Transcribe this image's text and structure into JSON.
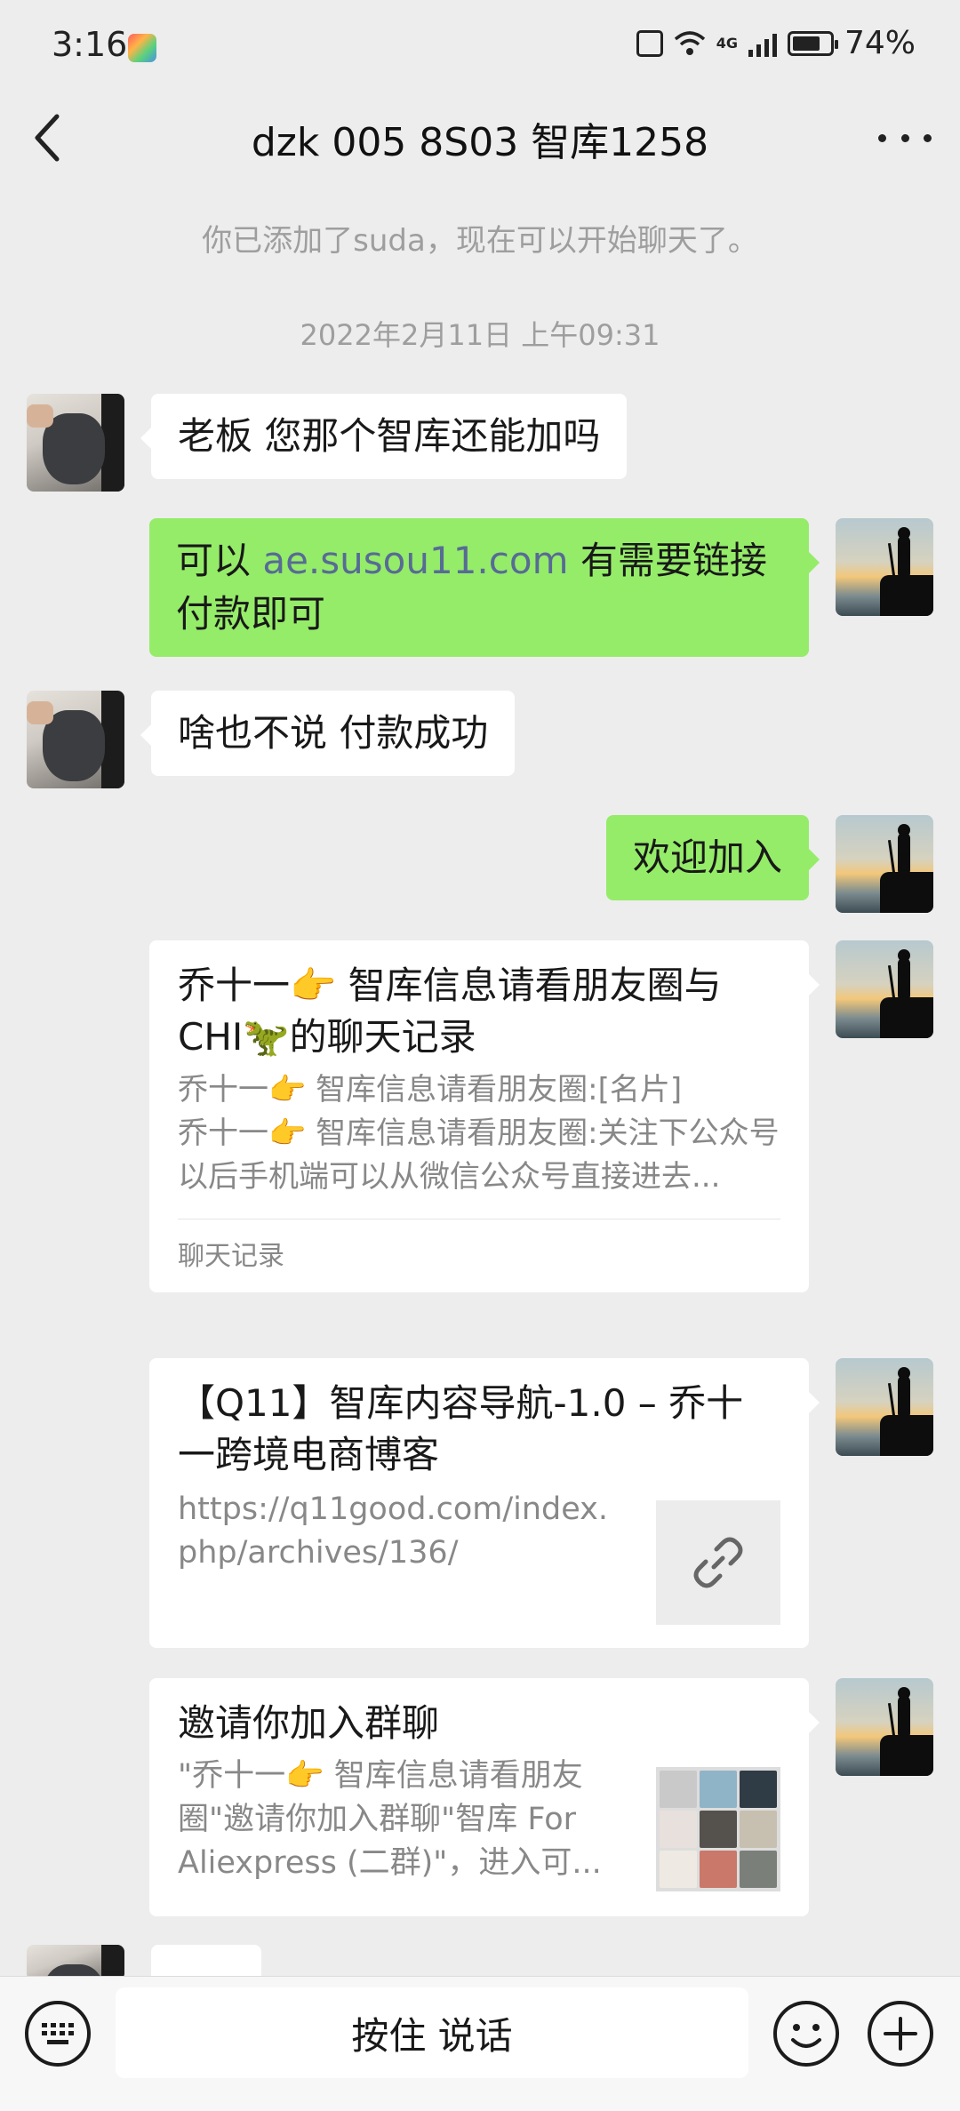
{
  "status_bar": {
    "time": "3:16",
    "network": "4G",
    "battery": "74%",
    "battery_level": 0.74
  },
  "header": {
    "title": "dzk 005 8S03 智库1258"
  },
  "system_messages": {
    "added_notice": "你已添加了suda，现在可以开始聊天了。",
    "timestamp": "2022年2月11日 上午09:31"
  },
  "messages": {
    "m1": {
      "text": "老板 您那个智库还能加吗"
    },
    "m2": {
      "prefix": "可以 ",
      "link": "ae.susou11.com",
      "suffix": " 有需要链接付款即可"
    },
    "m3": {
      "text": "啥也不说 付款成功"
    },
    "m4": {
      "text": "欢迎加入"
    },
    "m5": {
      "title": "乔十一👉 智库信息请看朋友圈与CHI🦖的聊天记录",
      "line1": "乔十一👉 智库信息请看朋友圈:[名片]",
      "line2": "乔十一👉 智库信息请看朋友圈:关注下公众号 以后手机端可以从微信公众号直接进去...",
      "footer": "聊天记录"
    },
    "m6": {
      "title": "【Q11】智库内容导航-1.0 – 乔十一跨境电商博客",
      "url": "https://q11good.com/index.php/archives/136/"
    },
    "m7": {
      "title": "邀请你加入群聊",
      "desc": "\"乔十一👉 智库信息请看朋友圈\"邀请你加入群聊\"智库 For Aliexpress (二群)\"，进入可..."
    }
  },
  "bottom_bar": {
    "voice_label": "按住 说话"
  },
  "icons": {
    "back": "chevron-left-icon",
    "more": "more-icon",
    "keyboard": "keyboard-icon",
    "emoji": "emoji-icon",
    "plus": "plus-icon",
    "link": "link-icon"
  },
  "colors": {
    "sent_bubble": "#95ec69",
    "received_bubble": "#ffffff",
    "background": "#ededed",
    "link": "#576b95"
  }
}
